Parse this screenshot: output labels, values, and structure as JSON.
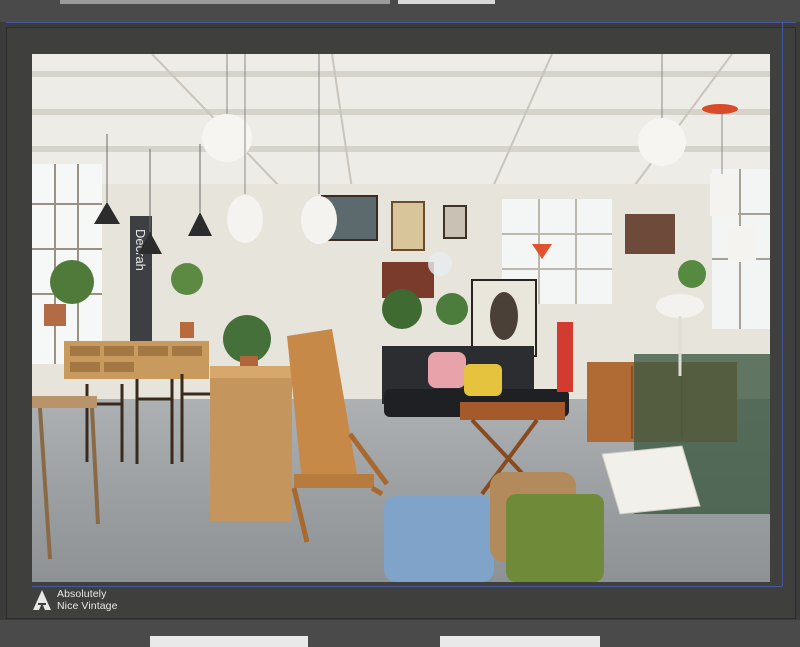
{
  "photo": {
    "subject": "vintage furniture showroom",
    "wall_sign": "Decrah"
  },
  "brand": {
    "line1": "Absolutely",
    "line2": "Nice Vintage",
    "logo_icon": "triangle-a-logo-icon"
  },
  "colors": {
    "frame": "#3f403e",
    "guide": "#4f64c9",
    "chair_blue": "#7fa3c9",
    "pouf_green": "#6f8b3a",
    "teak": "#a8612f"
  }
}
